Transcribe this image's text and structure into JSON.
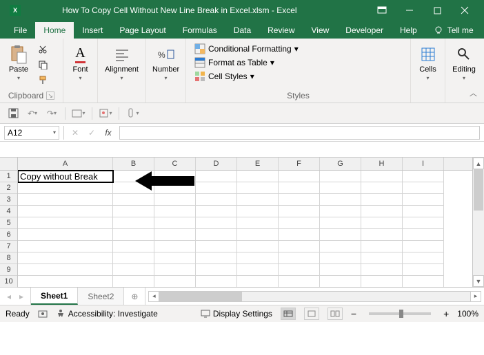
{
  "title": "How To Copy Cell Without New Line Break in Excel.xlsm  -  Excel",
  "tabs": [
    "File",
    "Home",
    "Insert",
    "Page Layout",
    "Formulas",
    "Data",
    "Review",
    "View",
    "Developer",
    "Help"
  ],
  "tellme": "Tell me",
  "activeTab": "Home",
  "ribbon": {
    "clipboard": {
      "label": "Clipboard",
      "paste": "Paste"
    },
    "font": {
      "label": "Font"
    },
    "alignment": {
      "label": "Alignment"
    },
    "number": {
      "label": "Number"
    },
    "styles": {
      "label": "Styles",
      "cond": "Conditional Formatting",
      "table": "Format as Table",
      "cell": "Cell Styles"
    },
    "cells": {
      "label": "Cells"
    },
    "editing": {
      "label": "Editing"
    }
  },
  "namebox": "A12",
  "cellA1": "Copy without Break",
  "columns": [
    "A",
    "B",
    "C",
    "D",
    "E",
    "F",
    "G",
    "H",
    "I"
  ],
  "rows": [
    "1",
    "2",
    "3",
    "4",
    "5",
    "6",
    "7",
    "8",
    "9",
    "10"
  ],
  "sheets": {
    "active": "Sheet1",
    "others": [
      "Sheet2"
    ]
  },
  "status": {
    "ready": "Ready",
    "access": "Accessibility: Investigate",
    "display": "Display Settings",
    "zoom": "100%"
  }
}
